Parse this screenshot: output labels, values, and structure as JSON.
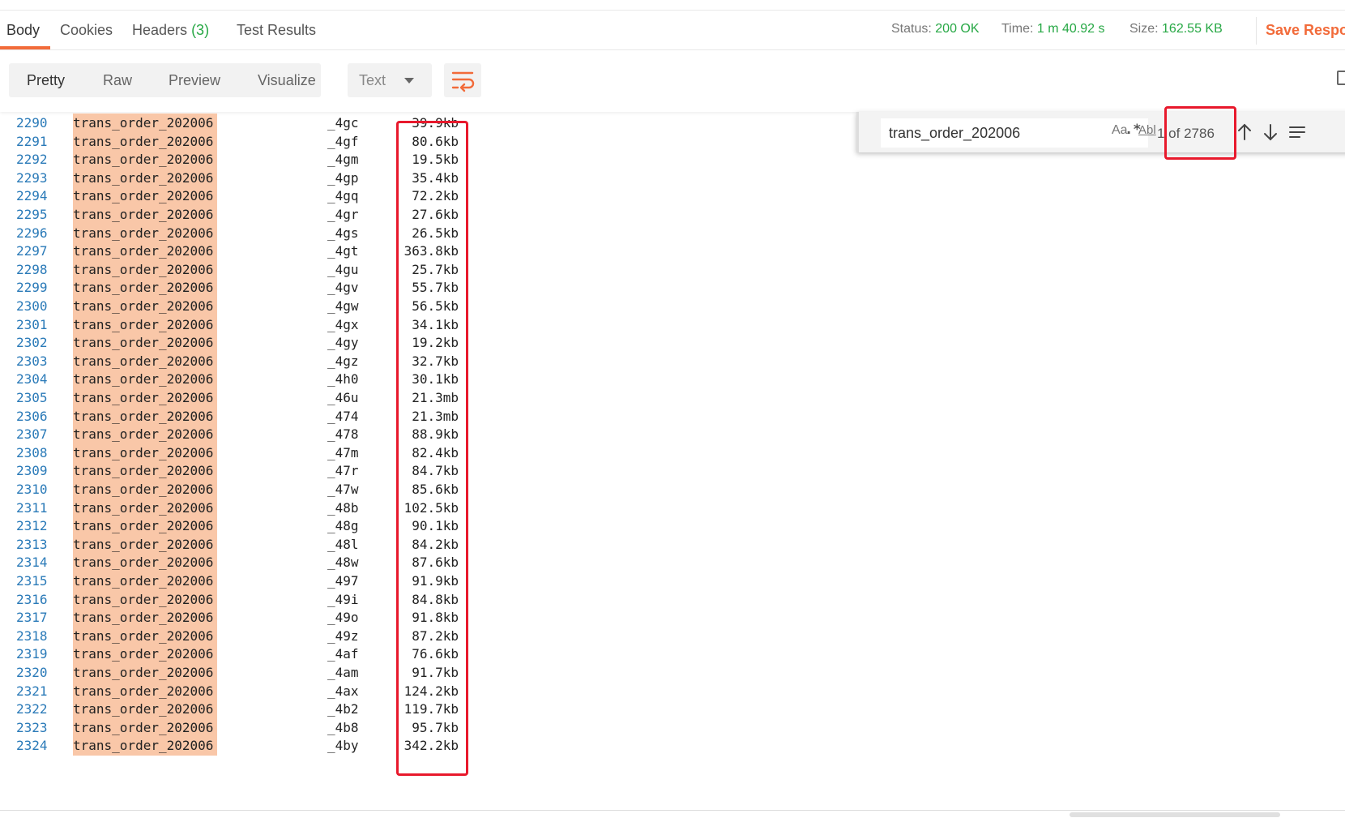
{
  "tabs": {
    "body": "Body",
    "cookies": "Cookies",
    "headers_label": "Headers",
    "headers_count": "(3)",
    "test_results": "Test Results"
  },
  "response_meta": {
    "status_label": "Status:",
    "status_value": "200 OK",
    "time_label": "Time:",
    "time_value": "1 m 40.92 s",
    "size_label": "Size:",
    "size_value": "162.55 KB",
    "save_label": "Save Respo"
  },
  "view_modes": {
    "pretty": "Pretty",
    "raw": "Raw",
    "preview": "Preview",
    "visualize": "Visualize"
  },
  "format_select": "Text",
  "find": {
    "value": "trans_order_202006",
    "match_case": "Aa",
    "whole_word": "Abl",
    "regex": ".*",
    "match_count": "1 of 2786"
  },
  "rows": [
    {
      "ln": "2290",
      "idx": "trans_order_202006",
      "shard": "_4gc",
      "size": "39.9kb"
    },
    {
      "ln": "2291",
      "idx": "trans_order_202006",
      "shard": "_4gf",
      "size": "80.6kb"
    },
    {
      "ln": "2292",
      "idx": "trans_order_202006",
      "shard": "_4gm",
      "size": "19.5kb"
    },
    {
      "ln": "2293",
      "idx": "trans_order_202006",
      "shard": "_4gp",
      "size": "35.4kb"
    },
    {
      "ln": "2294",
      "idx": "trans_order_202006",
      "shard": "_4gq",
      "size": "72.2kb"
    },
    {
      "ln": "2295",
      "idx": "trans_order_202006",
      "shard": "_4gr",
      "size": "27.6kb"
    },
    {
      "ln": "2296",
      "idx": "trans_order_202006",
      "shard": "_4gs",
      "size": "26.5kb"
    },
    {
      "ln": "2297",
      "idx": "trans_order_202006",
      "shard": "_4gt",
      "size": "363.8kb"
    },
    {
      "ln": "2298",
      "idx": "trans_order_202006",
      "shard": "_4gu",
      "size": "25.7kb"
    },
    {
      "ln": "2299",
      "idx": "trans_order_202006",
      "shard": "_4gv",
      "size": "55.7kb"
    },
    {
      "ln": "2300",
      "idx": "trans_order_202006",
      "shard": "_4gw",
      "size": "56.5kb"
    },
    {
      "ln": "2301",
      "idx": "trans_order_202006",
      "shard": "_4gx",
      "size": "34.1kb"
    },
    {
      "ln": "2302",
      "idx": "trans_order_202006",
      "shard": "_4gy",
      "size": "19.2kb"
    },
    {
      "ln": "2303",
      "idx": "trans_order_202006",
      "shard": "_4gz",
      "size": "32.7kb"
    },
    {
      "ln": "2304",
      "idx": "trans_order_202006",
      "shard": "_4h0",
      "size": "30.1kb"
    },
    {
      "ln": "2305",
      "idx": "trans_order_202006",
      "shard": "_46u",
      "size": "21.3mb"
    },
    {
      "ln": "2306",
      "idx": "trans_order_202006",
      "shard": "_474",
      "size": "21.3mb"
    },
    {
      "ln": "2307",
      "idx": "trans_order_202006",
      "shard": "_478",
      "size": "88.9kb"
    },
    {
      "ln": "2308",
      "idx": "trans_order_202006",
      "shard": "_47m",
      "size": "82.4kb"
    },
    {
      "ln": "2309",
      "idx": "trans_order_202006",
      "shard": "_47r",
      "size": "84.7kb"
    },
    {
      "ln": "2310",
      "idx": "trans_order_202006",
      "shard": "_47w",
      "size": "85.6kb"
    },
    {
      "ln": "2311",
      "idx": "trans_order_202006",
      "shard": "_48b",
      "size": "102.5kb"
    },
    {
      "ln": "2312",
      "idx": "trans_order_202006",
      "shard": "_48g",
      "size": "90.1kb"
    },
    {
      "ln": "2313",
      "idx": "trans_order_202006",
      "shard": "_48l",
      "size": "84.2kb"
    },
    {
      "ln": "2314",
      "idx": "trans_order_202006",
      "shard": "_48w",
      "size": "87.6kb"
    },
    {
      "ln": "2315",
      "idx": "trans_order_202006",
      "shard": "_497",
      "size": "91.9kb"
    },
    {
      "ln": "2316",
      "idx": "trans_order_202006",
      "shard": "_49i",
      "size": "84.8kb"
    },
    {
      "ln": "2317",
      "idx": "trans_order_202006",
      "shard": "_49o",
      "size": "91.8kb"
    },
    {
      "ln": "2318",
      "idx": "trans_order_202006",
      "shard": "_49z",
      "size": "87.2kb"
    },
    {
      "ln": "2319",
      "idx": "trans_order_202006",
      "shard": "_4af",
      "size": "76.6kb"
    },
    {
      "ln": "2320",
      "idx": "trans_order_202006",
      "shard": "_4am",
      "size": "91.7kb"
    },
    {
      "ln": "2321",
      "idx": "trans_order_202006",
      "shard": "_4ax",
      "size": "124.2kb"
    },
    {
      "ln": "2322",
      "idx": "trans_order_202006",
      "shard": "_4b2",
      "size": "119.7kb"
    },
    {
      "ln": "2323",
      "idx": "trans_order_202006",
      "shard": "_4b8",
      "size": "95.7kb"
    },
    {
      "ln": "2324",
      "idx": "trans_order_202006",
      "shard": "_4by",
      "size": "342.2kb"
    }
  ]
}
